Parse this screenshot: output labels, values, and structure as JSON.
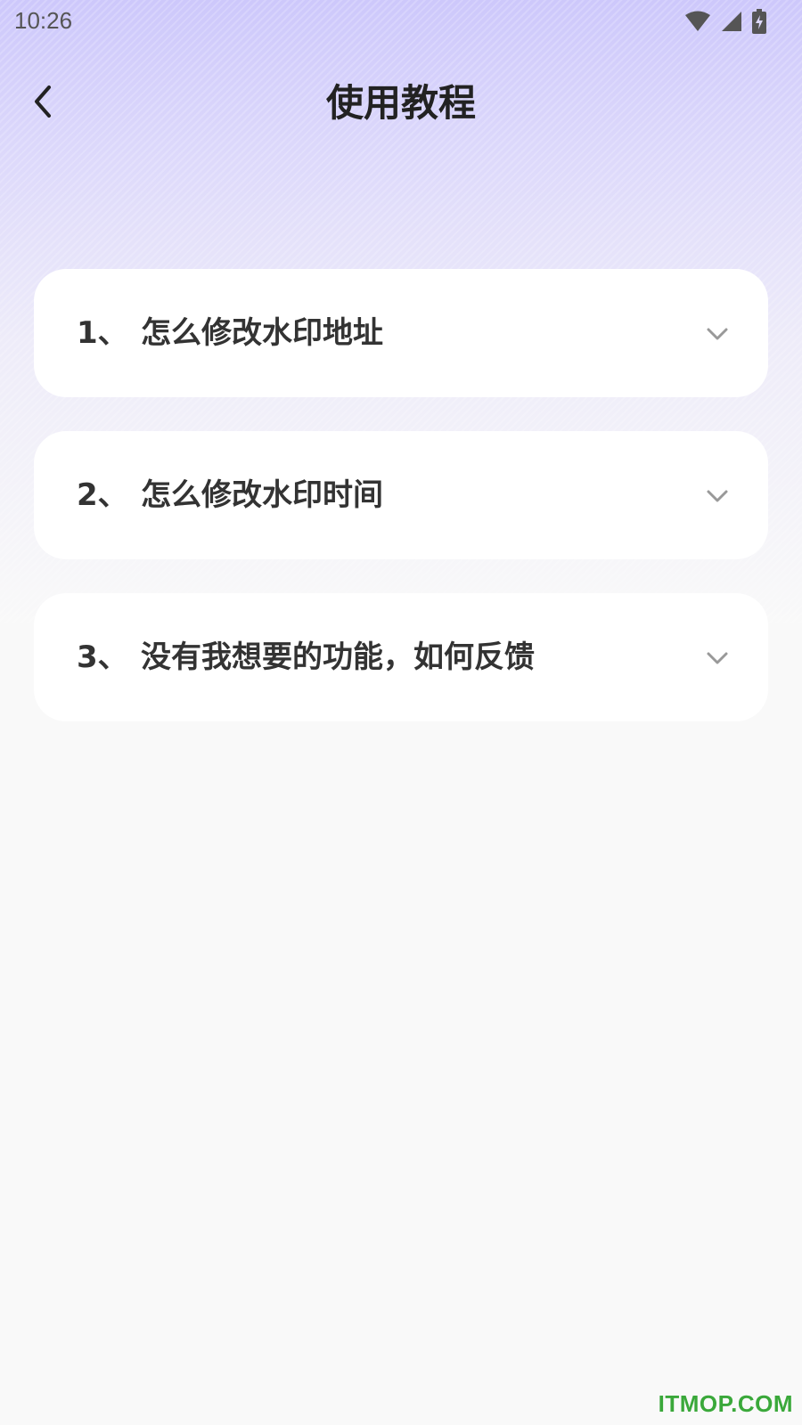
{
  "status_bar": {
    "time": "10:26",
    "icons": [
      "wifi-icon",
      "signal-icon",
      "battery-charging-icon"
    ]
  },
  "nav": {
    "back_icon": "chevron-left-icon",
    "title": "使用教程"
  },
  "faq": [
    {
      "number": "1、",
      "question": "怎么修改水印地址"
    },
    {
      "number": "2、",
      "question": "怎么修改水印时间"
    },
    {
      "number": "3、",
      "question": "没有我想要的功能，如何反馈"
    }
  ],
  "watermark": "ITMOP.COM",
  "colors": {
    "header_gradient_top": "#cdc8fb",
    "background": "#f9f9f9",
    "card": "#ffffff",
    "title_text": "#222222",
    "item_text": "#333333",
    "chevron": "#999999",
    "watermark": "#3aa83a"
  }
}
